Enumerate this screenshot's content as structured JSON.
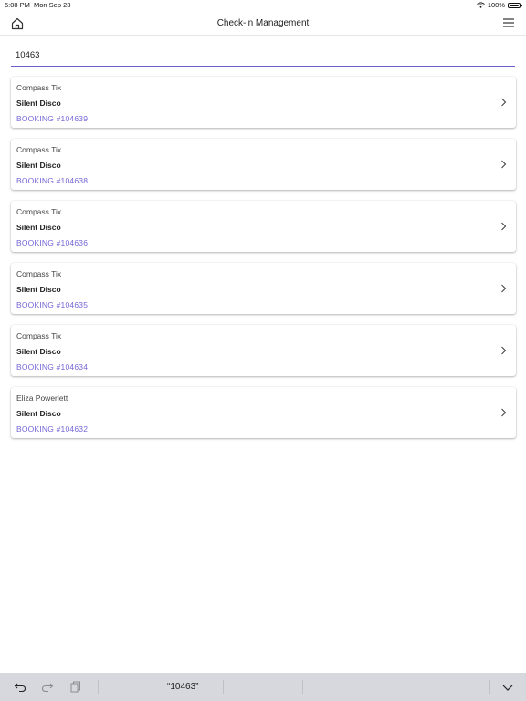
{
  "status": {
    "time": "5:08 PM",
    "date": "Mon Sep 23",
    "battery": "100%"
  },
  "nav": {
    "title": "Check-in Management"
  },
  "search": {
    "value": "10463"
  },
  "bookings": [
    {
      "client": "Compass Tix",
      "event": "Silent Disco",
      "booking": "BOOKING #104639"
    },
    {
      "client": "Compass Tix",
      "event": "Silent Disco",
      "booking": "BOOKING #104638"
    },
    {
      "client": "Compass Tix",
      "event": "Silent Disco",
      "booking": "BOOKING #104636"
    },
    {
      "client": "Compass Tix",
      "event": "Silent Disco",
      "booking": "BOOKING #104635"
    },
    {
      "client": "Compass Tix",
      "event": "Silent Disco",
      "booking": "BOOKING #104634"
    },
    {
      "client": "Eliza Powerlett",
      "event": "Silent Disco",
      "booking": "BOOKING #104632"
    }
  ],
  "keyboard": {
    "suggestion": "“10463”"
  },
  "colors": {
    "accent": "#7466d6",
    "keyboard_bar": "#d6d8dd"
  }
}
